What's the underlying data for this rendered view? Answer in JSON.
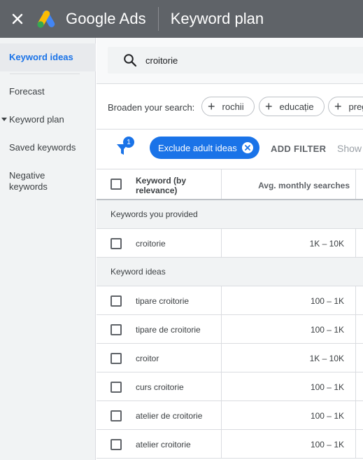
{
  "header": {
    "brand": "Google Ads",
    "page_title": "Keyword plan"
  },
  "sidebar": {
    "items": [
      {
        "label": "Keyword ideas",
        "active": true
      },
      {
        "label": "Forecast"
      },
      {
        "label": "Keyword plan",
        "expandable": true
      },
      {
        "label": "Saved keywords"
      },
      {
        "label": "Negative keywords"
      }
    ]
  },
  "search": {
    "value": "croitorie"
  },
  "broaden": {
    "label": "Broaden your search:",
    "chips": [
      "rochii",
      "educație",
      "preg"
    ]
  },
  "filters": {
    "count": "1",
    "active_chip": "Exclude adult ideas",
    "add_filter": "ADD FILTER",
    "show": "Show"
  },
  "table": {
    "columns": [
      "Keyword (by relevance)",
      "Avg. monthly searches"
    ],
    "group_provided": "Keywords you provided",
    "provided_rows": [
      {
        "keyword": "croitorie",
        "avg": "1K – 10K"
      }
    ],
    "group_ideas": "Keyword ideas",
    "idea_rows": [
      {
        "keyword": "tipare croitorie",
        "avg": "100 – 1K"
      },
      {
        "keyword": "tipare de croitorie",
        "avg": "100 – 1K"
      },
      {
        "keyword": "croitor",
        "avg": "1K – 10K"
      },
      {
        "keyword": "curs croitorie",
        "avg": "100 – 1K"
      },
      {
        "keyword": "atelier de croitorie",
        "avg": "100 – 1K"
      },
      {
        "keyword": "atelier croitorie",
        "avg": "100 – 1K"
      }
    ]
  },
  "colors": {
    "topbar": "#5f6368",
    "accent": "#1a73e8",
    "sidebar_bg": "#f1f3f4"
  }
}
